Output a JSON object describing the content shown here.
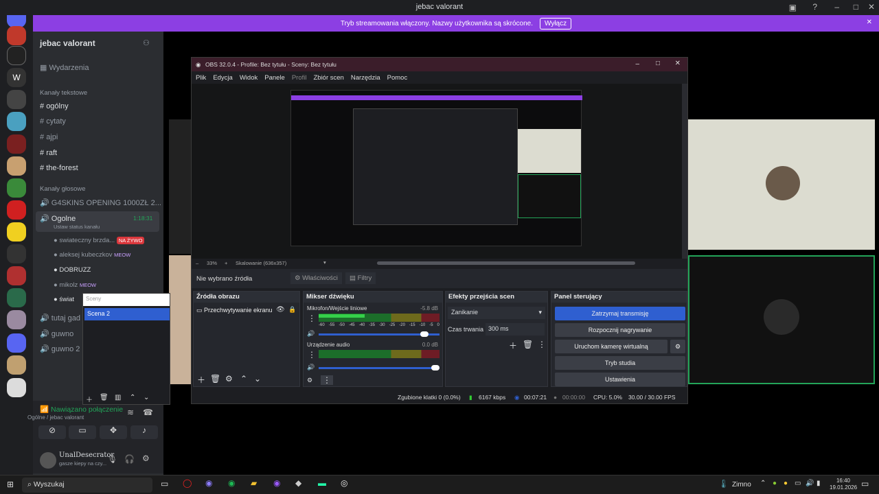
{
  "discord": {
    "window_title": "jebac valorant",
    "banner_text": "Tryb streamowania włączony. Nazwy użytkownika są skrócone.",
    "banner_button": "Wyłącz",
    "server_name": "jebac valorant",
    "events": "Wydarzenia",
    "text_category": "Kanały tekstowe",
    "text_channels": [
      "ogólny",
      "cytaty",
      "ajpi",
      "raft",
      "the-forest"
    ],
    "voice_category": "Kanały głosowe",
    "voice_channels": [
      "G4SKINS OPENING 1000ZŁ 2...",
      "Ogolne",
      "tutaj gad",
      "guwno",
      "guwno 2"
    ],
    "active_voice_time": "1:18:31",
    "voice_status_hint": "Ustaw status kanału",
    "voice_users": [
      {
        "name": "swiateczny brzda...",
        "badge": "NA ŻYWO"
      },
      {
        "name": "aleksej kubeczkov",
        "badge": "MEOW"
      },
      {
        "name": "DOBRUZZ",
        "badge": ""
      },
      {
        "name": "mikolz",
        "badge": "MEOW"
      },
      {
        "name": "świat",
        "badge": ""
      }
    ],
    "connection_status": "Nawiązano połączenie",
    "connection_sub": "Ogólne / jebac valorant",
    "user_name": "UnalDesecrator",
    "user_status": "gasze kiepy na czy..."
  },
  "scene_popup": {
    "header": "Sceny",
    "items": [
      "Scena 2"
    ]
  },
  "obs": {
    "title": "OBS 32.0.4 - Profile: Bez tytułu - Sceny: Bez tytułu",
    "menu": [
      "Plik",
      "Edycja",
      "Widok",
      "Panele",
      "Profil",
      "Zbiór scen",
      "Narzędzia",
      "Pomoc"
    ],
    "zoom": "33%",
    "scaling": "Skalowanie (636x357)",
    "no_source": "Nie wybrano źródła",
    "properties": "Właściwości",
    "filters": "Filtry",
    "sources_title": "Źródła obrazu",
    "sources": [
      "Przechwytywanie ekranu"
    ],
    "mixer_title": "Mikser dźwięku",
    "mixer": [
      {
        "name": "Mikrofon/Wejście liniowe",
        "db": "-5.8 dB",
        "level": 0.38,
        "volume": 0.9
      },
      {
        "name": "Urządzenie audio",
        "db": "0.0 dB",
        "level": 0.0,
        "volume": 1.0
      }
    ],
    "meter_ticks": [
      "-60",
      "-55",
      "-50",
      "-45",
      "-40",
      "-35",
      "-30",
      "-25",
      "-20",
      "-15",
      "-10",
      "-5",
      "0"
    ],
    "transitions_title": "Efekty przejścia scen",
    "transition": "Zanikanie",
    "duration_label": "Czas trwania",
    "duration": "300 ms",
    "controls_title": "Panel sterujący",
    "controls": [
      "Zatrzymaj transmisję",
      "Rozpocznij nagrywanie",
      "Uruchom kamerę wirtualną",
      "Tryb studia",
      "Ustawienia"
    ],
    "status": {
      "dropped": "Zgubione klatki 0 (0.0%)",
      "bitrate": "6167 kbps",
      "stream_time": "00:07:21",
      "rec_time": "00:00:00",
      "cpu": "CPU: 5.0%",
      "fps": "30.00 / 30.00 FPS"
    }
  },
  "taskbar": {
    "search": "Wyszukaj",
    "weather": "Zimno",
    "time": "16:40",
    "date": "19.01.2026"
  },
  "colors": {
    "accent": "#8c3fe3",
    "obs_stream_button": "#2f5fd0",
    "discord_green": "#23a559"
  }
}
